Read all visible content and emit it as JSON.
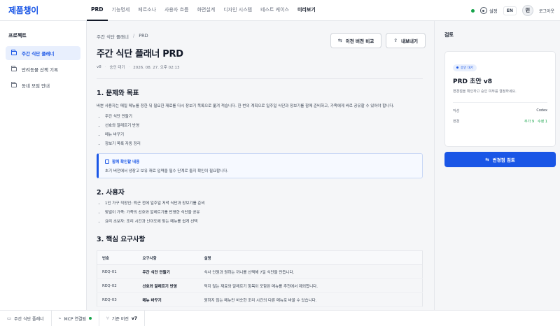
{
  "app": {
    "logo": "제품챙이"
  },
  "nav": {
    "items": [
      {
        "label": "PRD",
        "state": "active"
      },
      {
        "label": "기능명세",
        "state": "normal"
      },
      {
        "label": "페르소나",
        "state": "normal"
      },
      {
        "label": "사용자 흐름",
        "state": "normal"
      },
      {
        "label": "화면설계",
        "state": "normal"
      },
      {
        "label": "디자인 시스템",
        "state": "normal"
      },
      {
        "label": "테스트 케이스",
        "state": "normal"
      },
      {
        "label": "미리보기",
        "state": "bold"
      }
    ],
    "settings_label": "설정",
    "lang_label": "EN",
    "avatar_initial": "민",
    "logout_label": "로그아웃"
  },
  "sidebar": {
    "heading": "프로젝트",
    "items": [
      {
        "label": "주간 식단 플래너",
        "active": true
      },
      {
        "label": "반려동물 산책 기록",
        "active": false
      },
      {
        "label": "동네 모임 안내",
        "active": false
      }
    ]
  },
  "document": {
    "breadcrumb": [
      "주간 식단 플래너",
      "PRD"
    ],
    "breadcrumb_sep": "/",
    "title": "주간 식단 플래너 PRD",
    "version": "v8",
    "status": "승인 대기",
    "updated": "2026. 08. 27. 오후 02:13",
    "meta_sep": "·",
    "actions": {
      "compare": "이전 버전 비교",
      "export": "내보내기"
    },
    "section1": {
      "heading": "1. 문제와 목표",
      "paragraph": "바쁜 사용자는 매일 메뉴를 정한 뒤 필요한 재료를 다시 장보기 목록으로 옮겨 적습니다. 한 번의 계획으로 일주일 식단과 장보기를 함께 준비하고, 가족에게 바로 공유할 수 있어야 합니다.",
      "bullets": [
        "주간 식단 만들기",
        "선호와 알레르기 반영",
        "메뉴 바꾸기",
        "장보기 목록 자동 정리"
      ],
      "callout_title": "함께 확인할 내용",
      "callout_body": "초기 버전에서 냉장고 보유 재료 입력을 필수 단계로 둘지 확인이 필요합니다."
    },
    "section2": {
      "heading": "2. 사용자",
      "bullets": [
        "1인 가구 직장인: 퇴근 전에 일주일 저녁 식단과 장보기를 준비",
        "맞벌이 가족: 가족의 선호와 알레르기를 반영한 식단을 공유",
        "요리 초보자: 조리 시간과 난이도에 맞는 메뉴를 쉽게 선택"
      ]
    },
    "section3": {
      "heading": "3. 핵심 요구사항",
      "columns": [
        "번호",
        "요구사항",
        "설명"
      ],
      "rows": [
        [
          "REQ-01",
          "주간 식단 만들기",
          "식사 인원과 원하는 끼니를 선택해 7일 식단을 만듭니다."
        ],
        [
          "REQ-02",
          "선호와 알레르기 반영",
          "먹지 않는 재료와 알레르기 항목이 포함된 메뉴를 추천에서 제외합니다."
        ],
        [
          "REQ-03",
          "메뉴 바꾸기",
          "원하지 않는 메뉴만 비슷한 조리 시간의 다른 메뉴로 바꿀 수 있습니다."
        ]
      ]
    }
  },
  "review": {
    "heading": "검토",
    "chip": "승인 대기",
    "card_title": "PRD 초안 v8",
    "card_sub": "변경점을 확인하고 승인 여부를 결정하세요.",
    "author_key": "작성",
    "author_val": "Codex",
    "change_key": "변경",
    "change_added": "추가 9",
    "change_modified": "수정 1",
    "primary_button": "변경점 검토"
  },
  "statusbar": {
    "project": "주간 식단 플래너",
    "mcp_label": "MCP 연결됨",
    "base_version_label": "기준 버전",
    "base_version_value": "v7"
  },
  "colors": {
    "accent": "#1a56e6",
    "success": "#16a34a"
  },
  "icons": [
    "folder-icon",
    "gear-icon",
    "compare-icon",
    "export-icon",
    "note-icon",
    "review-icon",
    "doc-icon",
    "link-icon",
    "branch-icon"
  ]
}
